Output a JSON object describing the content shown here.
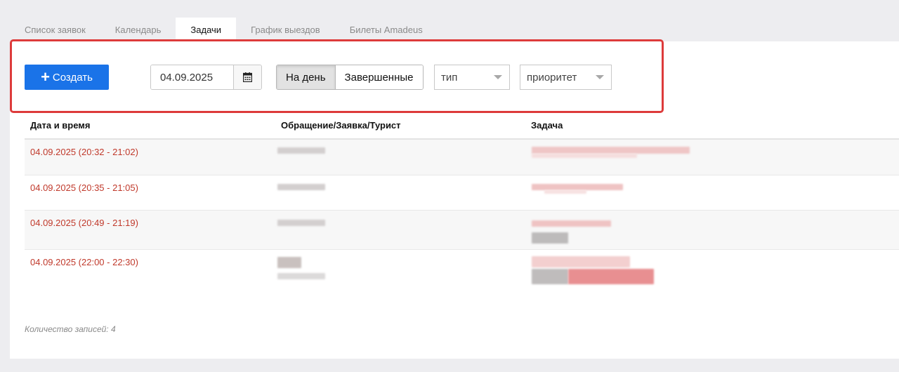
{
  "tabs": [
    {
      "label": "Список заявок",
      "active": false
    },
    {
      "label": "Календарь",
      "active": false
    },
    {
      "label": "Задачи",
      "active": true
    },
    {
      "label": "График выездов",
      "active": false
    },
    {
      "label": "Билеты Amadeus",
      "active": false
    }
  ],
  "toolbar": {
    "create_label": "Создать",
    "create_icon": "plus-icon",
    "date_value": "04.09.2025",
    "calendar_icon": "calendar-icon",
    "day_label": "На день",
    "completed_label": "Завершенные",
    "type_placeholder": "тип",
    "priority_placeholder": "приоритет"
  },
  "table": {
    "headers": [
      "Дата и время",
      "Обращение/Заявка/Турист",
      "Задача"
    ],
    "rows": [
      {
        "datetime": "04.09.2025 (20:32 - 21:02)"
      },
      {
        "datetime": "04.09.2025 (20:35 - 21:05)"
      },
      {
        "datetime": "04.09.2025 (20:49 - 21:19)"
      },
      {
        "datetime": "04.09.2025 (22:00 - 22:30)"
      }
    ]
  },
  "footer": {
    "count_text": "Количество записей: 4"
  },
  "colors": {
    "accent": "#1a73e8",
    "date_text": "#c0392b",
    "highlight": "#dd3b3b"
  }
}
